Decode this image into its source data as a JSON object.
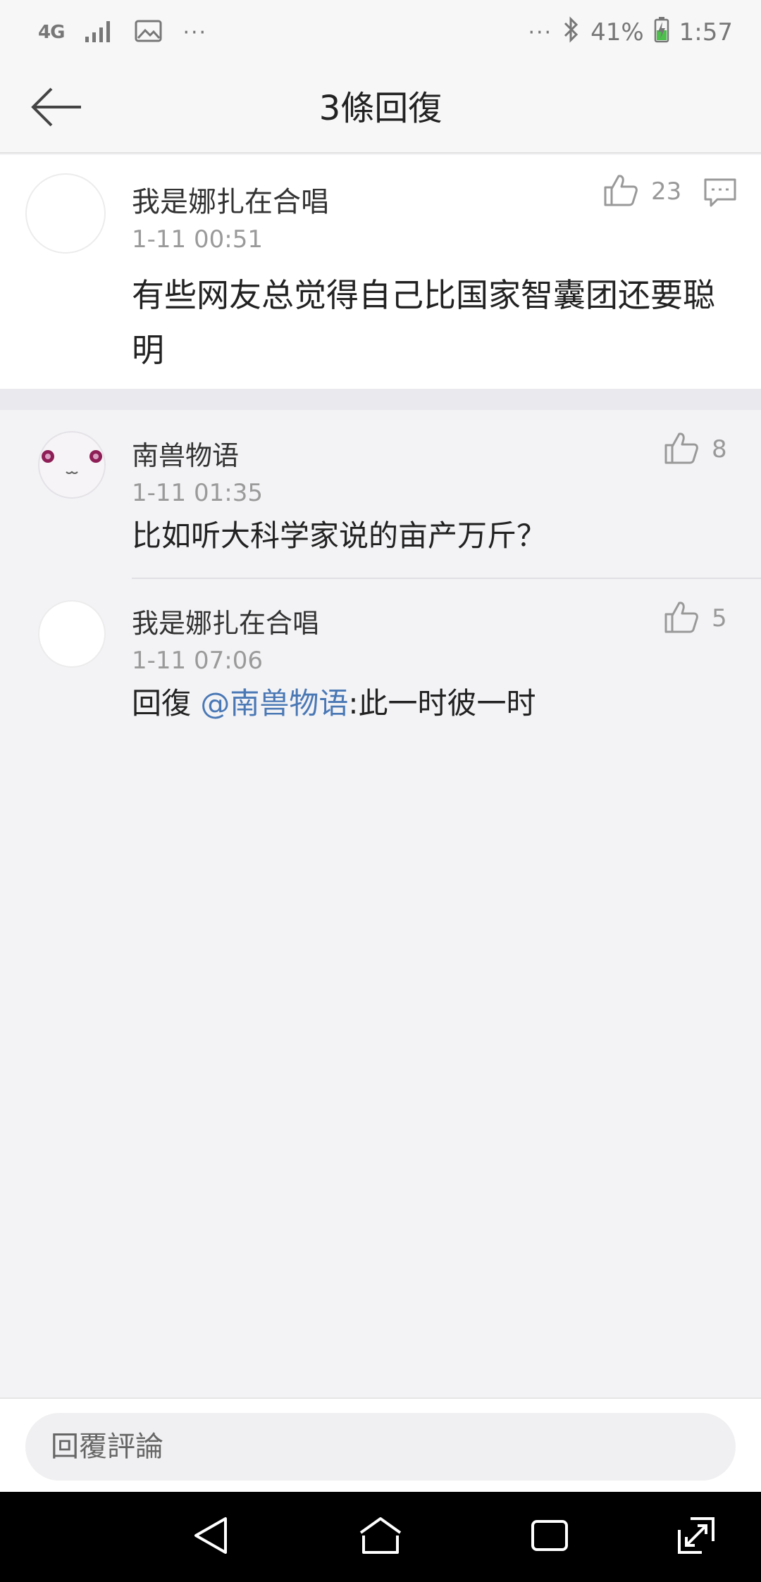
{
  "status_bar": {
    "network": "4G",
    "battery": "41%",
    "time": "1:57",
    "icons": [
      "signal-icon",
      "image-icon",
      "more-icon",
      "bluetooth-icon",
      "battery-icon"
    ]
  },
  "header": {
    "title": "3條回復",
    "back_icon": "arrow-left-icon"
  },
  "main_comment": {
    "author": "我是娜扎在合唱",
    "time": "1-11 00:51",
    "text": "有些网友总觉得自己比国家智囊团还要聪明",
    "likes": "23"
  },
  "replies": [
    {
      "author": "南兽物语",
      "time": "1-11 01:35",
      "text": "比如听大科学家说的亩产万斤？",
      "likes": "8"
    },
    {
      "author": "我是娜扎在合唱",
      "time": "1-11 07:06",
      "reply_prefix": "回復 ",
      "mention": "@南兽物语",
      "text": ":此一时彼一时",
      "likes": "5"
    }
  ],
  "footer": {
    "placeholder": "回覆評論"
  },
  "colors": {
    "mention": "#4a78b5",
    "nav_bar": "#000000",
    "avatar_eye": "#8e1e56"
  }
}
